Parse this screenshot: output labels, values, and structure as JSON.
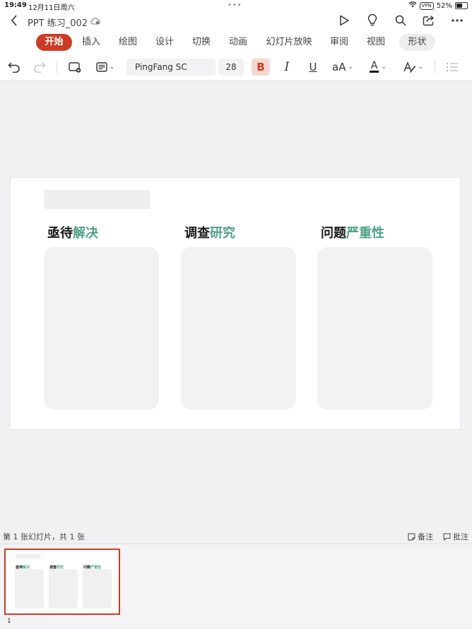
{
  "status_bar": {
    "time": "19:49",
    "date": "12月11日周六",
    "dots": "•••",
    "vpn": "VPN",
    "battery": "52%"
  },
  "title_bar": {
    "document_title": "PPT 练习_002"
  },
  "menu_tabs": [
    {
      "label": "开始",
      "active": true
    },
    {
      "label": "插入"
    },
    {
      "label": "绘图"
    },
    {
      "label": "设计"
    },
    {
      "label": "切换"
    },
    {
      "label": "动画"
    },
    {
      "label": "幻灯片放映"
    },
    {
      "label": "审阅"
    },
    {
      "label": "视图"
    },
    {
      "label": "形状",
      "pill": true
    }
  ],
  "toolbar": {
    "font_name": "PingFang SC",
    "font_size": "28",
    "bold_label": "B",
    "italic_label": "I",
    "underline_label": "U",
    "case_label": "aA",
    "font_color_label": "A"
  },
  "slide": {
    "columns": [
      {
        "heading_main": "亟待",
        "heading_accent": "解决"
      },
      {
        "heading_main": "调查",
        "heading_accent": "研究"
      },
      {
        "heading_main": "问题",
        "heading_accent": "严重性"
      }
    ]
  },
  "footer": {
    "slide_status": "第 1 张幻灯片，共 1 张",
    "notes_label": "备注",
    "comments_label": "批注"
  },
  "thumbnail": {
    "number": "1"
  },
  "colors": {
    "accent": "#cf3a22",
    "heading_accent": "#4ea286"
  }
}
